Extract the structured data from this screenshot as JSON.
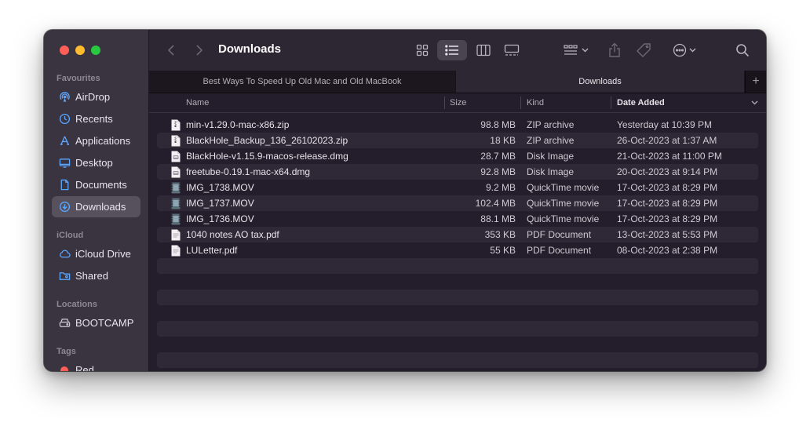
{
  "sidebar": {
    "favourites_label": "Favourites",
    "favourites": [
      {
        "label": "AirDrop",
        "icon": "airdrop-icon"
      },
      {
        "label": "Recents",
        "icon": "clock-icon"
      },
      {
        "label": "Applications",
        "icon": "applications-icon"
      },
      {
        "label": "Desktop",
        "icon": "desktop-icon"
      },
      {
        "label": "Documents",
        "icon": "document-icon"
      },
      {
        "label": "Downloads",
        "icon": "download-icon",
        "selected": true
      }
    ],
    "icloud_label": "iCloud",
    "icloud": [
      {
        "label": "iCloud Drive",
        "icon": "cloud-icon"
      },
      {
        "label": "Shared",
        "icon": "shared-folder-icon"
      }
    ],
    "locations_label": "Locations",
    "locations": [
      {
        "label": "BOOTCAMP",
        "icon": "drive-icon"
      }
    ],
    "tags_label": "Tags",
    "tags": [
      {
        "label": "Red",
        "color": "#ff5f57"
      }
    ]
  },
  "toolbar": {
    "title": "Downloads"
  },
  "tabs": [
    {
      "label": "Best Ways To Speed Up Old Mac and Old MacBook",
      "active": false
    },
    {
      "label": "Downloads",
      "active": true
    }
  ],
  "tab_add": "+",
  "columns": {
    "name": "Name",
    "size": "Size",
    "kind": "Kind",
    "date": "Date Added"
  },
  "files": [
    {
      "name": "min-v1.29.0-mac-x86.zip",
      "size": "98.8 MB",
      "kind": "ZIP archive",
      "date": "Yesterday at 10:39 PM",
      "icon": "zip-file-icon"
    },
    {
      "name": "BlackHole_Backup_136_26102023.zip",
      "size": "18 KB",
      "kind": "ZIP archive",
      "date": "26-Oct-2023 at 1:37 AM",
      "icon": "zip-file-icon"
    },
    {
      "name": "BlackHole-v1.15.9-macos-release.dmg",
      "size": "28.7 MB",
      "kind": "Disk Image",
      "date": "21-Oct-2023 at 11:00 PM",
      "icon": "disk-image-icon"
    },
    {
      "name": "freetube-0.19.1-mac-x64.dmg",
      "size": "92.8 MB",
      "kind": "Disk Image",
      "date": "20-Oct-2023 at 9:14 PM",
      "icon": "disk-image-icon"
    },
    {
      "name": "IMG_1738.MOV",
      "size": "9.2 MB",
      "kind": "QuickTime movie",
      "date": "17-Oct-2023 at 8:29 PM",
      "icon": "movie-file-icon"
    },
    {
      "name": "IMG_1737.MOV",
      "size": "102.4 MB",
      "kind": "QuickTime movie",
      "date": "17-Oct-2023 at 8:29 PM",
      "icon": "movie-file-icon"
    },
    {
      "name": "IMG_1736.MOV",
      "size": "88.1 MB",
      "kind": "QuickTime movie",
      "date": "17-Oct-2023 at 8:29 PM",
      "icon": "movie-file-icon"
    },
    {
      "name": "1040 notes AO tax.pdf",
      "size": "353 KB",
      "kind": "PDF Document",
      "date": "13-Oct-2023 at 5:53 PM",
      "icon": "pdf-file-icon"
    },
    {
      "name": "LULetter.pdf",
      "size": "55 KB",
      "kind": "PDF Document",
      "date": "08-Oct-2023 at 2:38 PM",
      "icon": "pdf-file-icon"
    }
  ]
}
